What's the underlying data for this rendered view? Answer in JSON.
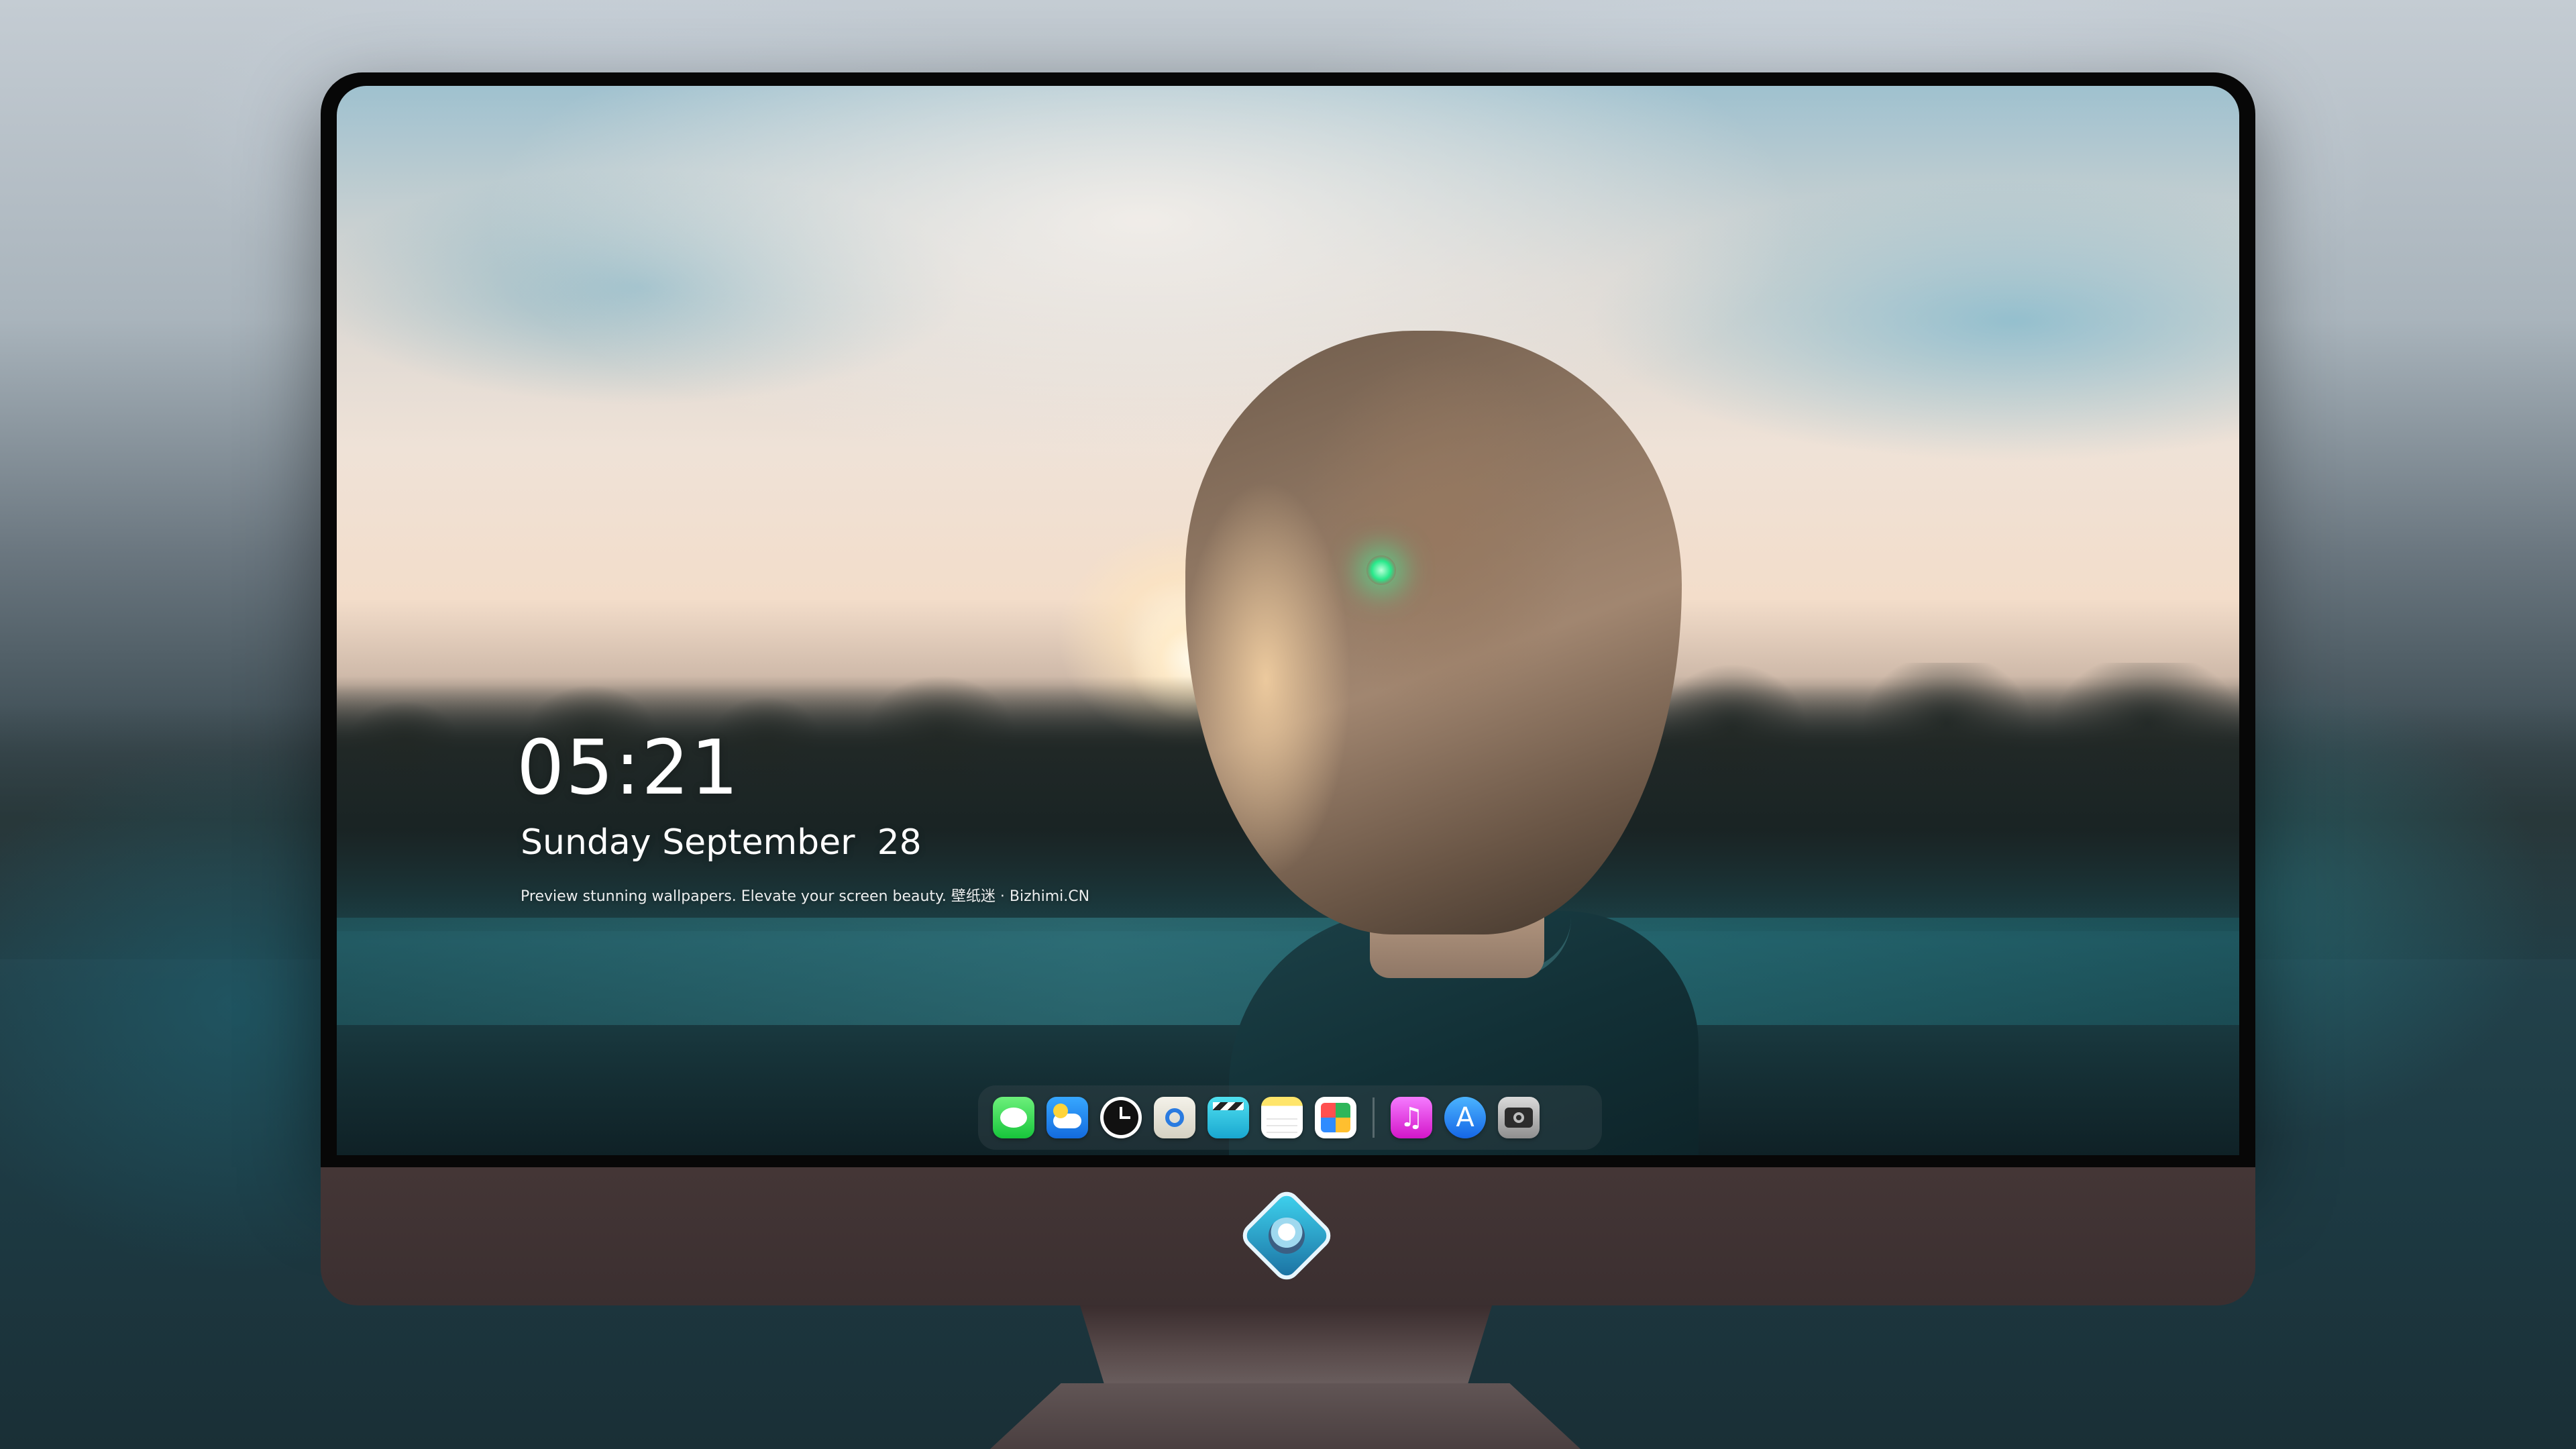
{
  "lock_screen": {
    "time": "05:21",
    "date": "Sunday September  28",
    "tagline": "Preview stunning wallpapers. Elevate your screen beauty. 壁纸迷 · Bizhimi.CN"
  },
  "dock": {
    "items": [
      {
        "name": "messages",
        "icon": "messages-icon",
        "color": "#28d34a"
      },
      {
        "name": "weather",
        "icon": "weather-icon",
        "color": "#1f8bf0"
      },
      {
        "name": "clock",
        "icon": "clock-icon",
        "color": "#111111"
      },
      {
        "name": "preview",
        "icon": "preview-icon",
        "color": "#e8e4d8"
      },
      {
        "name": "clips",
        "icon": "clapperboard-icon",
        "color": "#2bbfe0"
      },
      {
        "name": "notes",
        "icon": "notes-icon",
        "color": "#ffe56a"
      },
      {
        "name": "photos",
        "icon": "photos-icon",
        "color": "#ffffff"
      },
      {
        "name": "music",
        "icon": "music-note-icon",
        "color": "#e33ee0"
      },
      {
        "name": "app-store",
        "icon": "app-store-icon",
        "color": "#2d8bf5"
      },
      {
        "name": "camera",
        "icon": "camera-icon",
        "color": "#a8a8a8"
      }
    ]
  },
  "device": {
    "type": "desktop monitor",
    "bezel_color": "#070707",
    "chin_color": "#3e3233",
    "logo_icon": "diamond-mascot-logo-icon"
  },
  "glyphs": {
    "music": "♫",
    "appstore": "A"
  }
}
